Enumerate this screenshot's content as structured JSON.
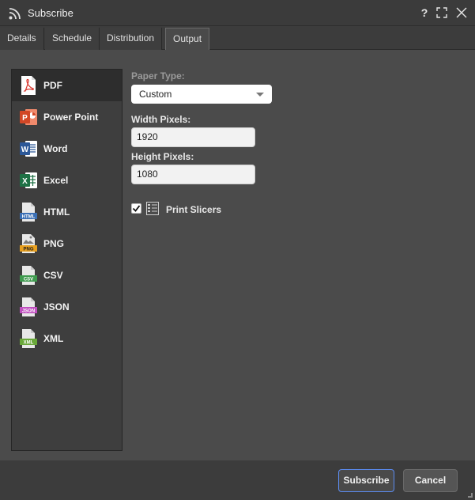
{
  "window": {
    "title": "Subscribe",
    "help_label": "?",
    "rss_icon": "rss-icon",
    "maximize_icon": "maximize-icon",
    "close_icon": "close-icon"
  },
  "tabs": [
    {
      "label": "Details"
    },
    {
      "label": "Schedule"
    },
    {
      "label": "Distribution"
    },
    {
      "label": "Output",
      "active": true
    }
  ],
  "formats": [
    {
      "label": "PDF",
      "icon": "pdf-icon",
      "color": "#d9342b",
      "active": true
    },
    {
      "label": "Power Point",
      "icon": "powerpoint-icon",
      "color": "#d24726"
    },
    {
      "label": "Word",
      "icon": "word-icon",
      "color": "#2b5797"
    },
    {
      "label": "Excel",
      "icon": "excel-icon",
      "color": "#1e7145"
    },
    {
      "label": "HTML",
      "icon": "html-icon",
      "tag": "HTML",
      "color": "#3a6fb5"
    },
    {
      "label": "PNG",
      "icon": "png-icon",
      "tag": "PNG",
      "color": "#e8a020"
    },
    {
      "label": "CSV",
      "icon": "csv-icon",
      "tag": "CSV",
      "color": "#3f9b4f"
    },
    {
      "label": "JSON",
      "icon": "json-icon",
      "tag": "JSON",
      "color": "#c04fc0"
    },
    {
      "label": "XML",
      "icon": "xml-icon",
      "tag": "XML",
      "color": "#6aa83a"
    }
  ],
  "output": {
    "paper_type_label": "Paper Type:",
    "paper_type_value": "Custom",
    "width_label": "Width Pixels:",
    "width_value": "1920",
    "height_label": "Height Pixels:",
    "height_value": "1080",
    "print_slicers_label": "Print Slicers",
    "print_slicers_checked": true
  },
  "footer": {
    "subscribe_label": "Subscribe",
    "cancel_label": "Cancel"
  },
  "colors": {
    "accent": "#5b8bf0",
    "background": "#4b4b4b",
    "panel": "#3e3e3e"
  }
}
